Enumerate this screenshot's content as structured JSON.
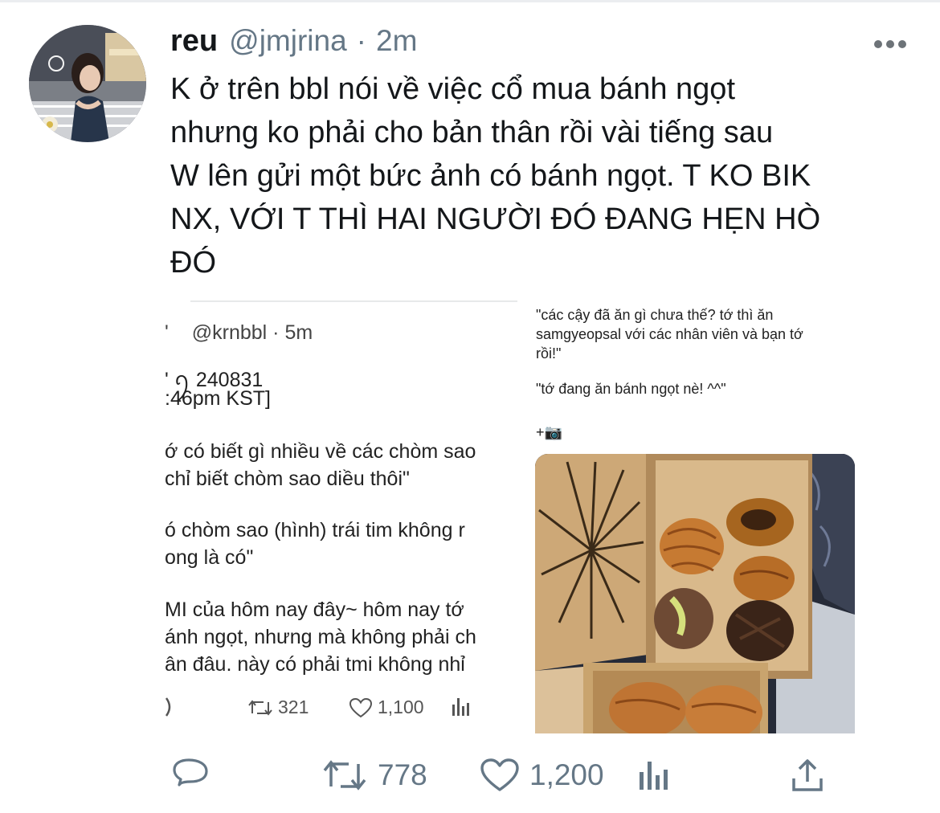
{
  "tweet": {
    "name": "reu",
    "handle": "@jmjrina",
    "separator": "·",
    "time": "2m",
    "text": "K ở trên bbl nói về việc cổ mua bánh ngọt\nnhưng ko phải cho bản thân rồi vài tiếng sau\nW lên gửi một bức ảnh có bánh ngọt. T KO BIK\nNX, VỚI T THÌ HAI NGƯỜI ĐÓ ĐANG HẸN HÒ\nĐÓ"
  },
  "embedded": {
    "left": {
      "prefix_glyph": "'",
      "handle": "@krnbbl",
      "separator": "·",
      "time": "5m",
      "lines": [
        "' ꪆ  240831",
        ":46pm KST]",
        "",
        "ớ có biết gì nhiều về các chòm sao",
        " chỉ biết chòm sao diều thôi\"",
        "",
        "ó chòm sao (hình) trái tim không r",
        "ong là có\"",
        "",
        "MI của hôm nay đây~ hôm nay tớ",
        "ánh ngọt, nhưng mà không phải ch",
        "ân đâu. này có phải tmi không nhỉ"
      ],
      "retweets": "321",
      "likes": "1,100"
    },
    "right": {
      "lines": [
        "\"các cậy đã ăn gì chưa thế? tớ thì ăn",
        "samgyeopsal với các nhân viên và bạn tớ",
        "rồi!\"",
        "",
        "\"tớ đang ăn bánh ngọt nè! ^^\"",
        "",
        "+📷"
      ]
    }
  },
  "actions": {
    "retweets": "778",
    "likes": "1,200"
  },
  "icons": {
    "more": "more-horizontal-icon",
    "reply": "reply-icon",
    "retweet": "retweet-icon",
    "like": "heart-icon",
    "analytics": "analytics-icon",
    "share": "share-icon"
  },
  "colors": {
    "muted": "#657786",
    "text": "#14171a"
  }
}
